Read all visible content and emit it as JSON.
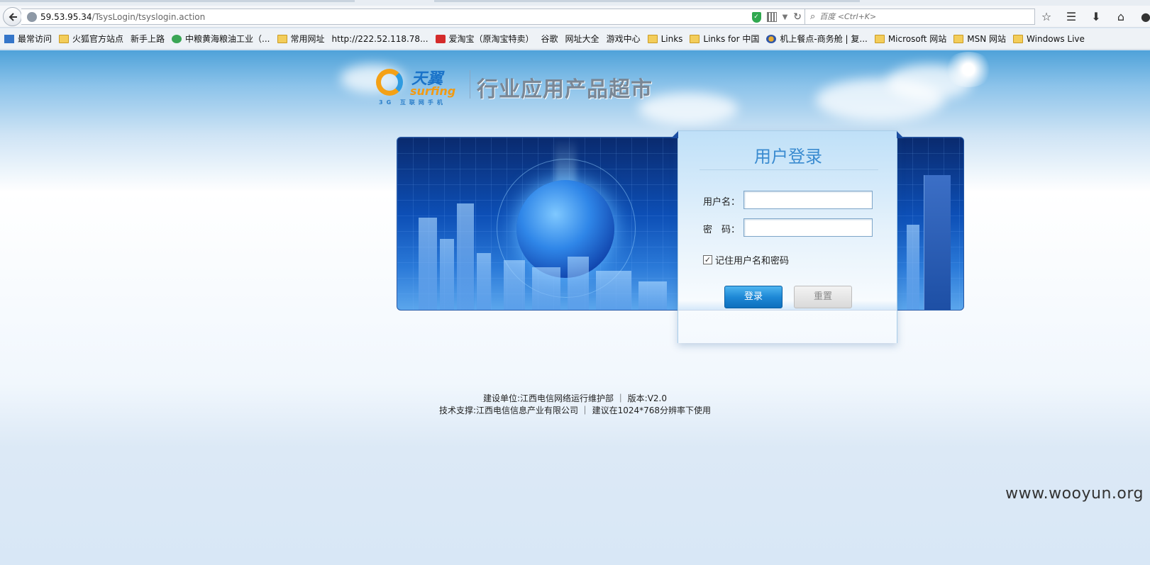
{
  "browser": {
    "url_host": "59.53.95.34",
    "url_path": "/TsysLogin/tsyslogin.action",
    "search_placeholder": "百度 <Ctrl+K>",
    "icons": {
      "back": "back-arrow-icon",
      "site": "globe-icon",
      "security": "shield-icon",
      "qr": "qr-code-icon",
      "reload": "reload-icon",
      "search": "search-icon",
      "bookmark_star": "star-icon",
      "reading_list": "list-icon",
      "downloads": "download-icon",
      "home": "home-icon"
    }
  },
  "bookmarks": [
    {
      "label": "最常访问",
      "icon": "blue"
    },
    {
      "label": "火狐官方站点",
      "icon": "folder"
    },
    {
      "label": "新手上路",
      "icon": "page"
    },
    {
      "label": "中粮黄海粮油工业（...",
      "icon": "green"
    },
    {
      "label": "常用网址",
      "icon": "folder"
    },
    {
      "label": "http://222.52.118.78...",
      "icon": "page"
    },
    {
      "label": "爱淘宝（原淘宝特卖）",
      "icon": "red"
    },
    {
      "label": "谷歌",
      "icon": "page"
    },
    {
      "label": "网址大全",
      "icon": "page"
    },
    {
      "label": "游戏中心",
      "icon": "page"
    },
    {
      "label": "Links",
      "icon": "folder"
    },
    {
      "label": "Links for 中国",
      "icon": "folder"
    },
    {
      "label": "机上餐点-商务舱 | 复...",
      "icon": "firefox"
    },
    {
      "label": "Microsoft 网站",
      "icon": "folder"
    },
    {
      "label": "MSN 网站",
      "icon": "folder"
    },
    {
      "label": "Windows Live",
      "icon": "folder"
    }
  ],
  "header": {
    "logo_cn": "天翼",
    "logo_en": "surfing",
    "logo_tagline": "3G 互联网手机",
    "site_title": "行业应用产品超市"
  },
  "login": {
    "title": "用户登录",
    "username_label": "用户名：",
    "username_value": "",
    "password_label": "密　码：",
    "password_value": "",
    "remember_label": "记住用户名和密码",
    "remember_checked": true,
    "login_button": "登录",
    "reset_button": "重置"
  },
  "footer": {
    "line1": "建设单位:江西电信网络运行维护部 ｜ 版本:V2.0",
    "line2": "技术支撑:江西电信信息产业有限公司 ｜ 建议在1024*768分辨率下使用"
  },
  "watermark": "www.wooyun.org",
  "colors": {
    "accent": "#1e88d6",
    "title_blue": "#3a8bd0",
    "logo_orange": "#f29a12"
  }
}
